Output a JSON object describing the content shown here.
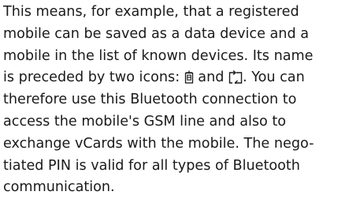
{
  "paragraph": {
    "line1": "This means, for example, that a registered",
    "line2": "mobile can be saved as a data device and a",
    "line3": "mobile in the list of known devices. Its name",
    "line4_before": "is preceded by two icons: ",
    "line4_middle": " and ",
    "line4_after": ". You can",
    "line5": "therefore use this Bluetooth connection to",
    "line6": "access the mobile's GSM line and also to",
    "line7": "exchange vCards with the mobile. The nego-",
    "line8": "tiated PIN is valid for all types of Bluetooth",
    "line9": "communication.",
    "icons": [
      "data-device-icon",
      "mobile-transfer-icon"
    ]
  }
}
